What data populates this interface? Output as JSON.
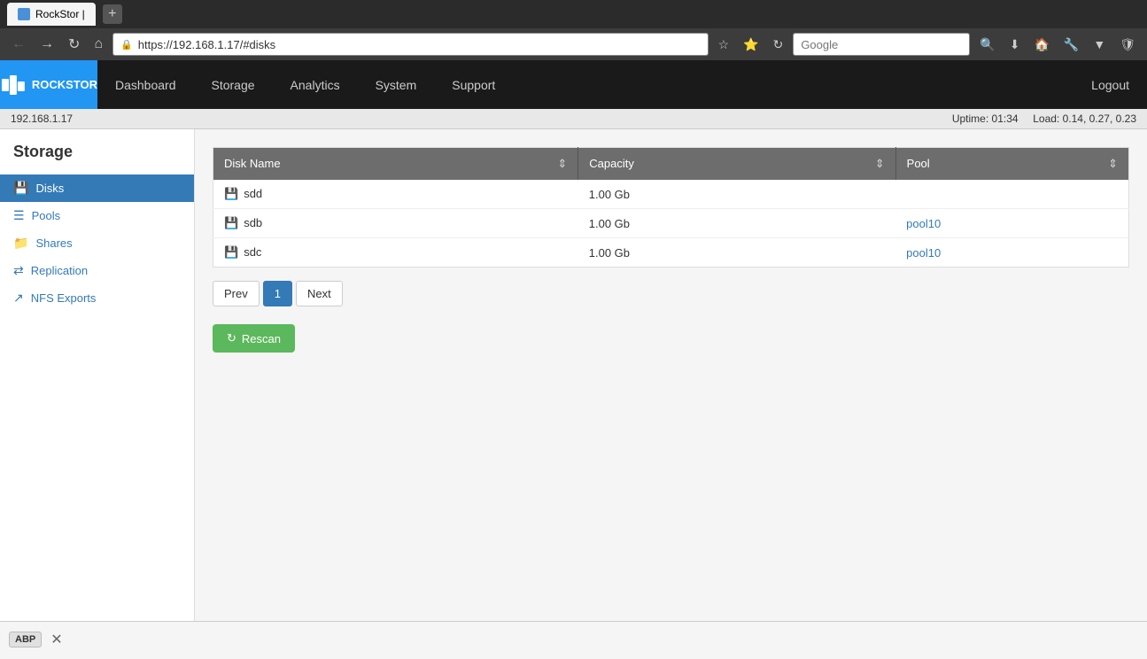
{
  "browser": {
    "tab_title": "RockStor |",
    "url": "https://192.168.1.17/#disks",
    "new_tab_symbol": "+",
    "search_placeholder": "Google"
  },
  "status_bar": {
    "ip": "192.168.1.17",
    "uptime_label": "Uptime: 01:34",
    "load_label": "Load: 0.14, 0.27, 0.23"
  },
  "app_header": {
    "logo_text": "ROCKSTOR",
    "nav_items": [
      {
        "id": "dashboard",
        "label": "Dashboard"
      },
      {
        "id": "storage",
        "label": "Storage"
      },
      {
        "id": "analytics",
        "label": "Analytics"
      },
      {
        "id": "system",
        "label": "System"
      },
      {
        "id": "support",
        "label": "Support"
      }
    ],
    "logout_label": "Logout"
  },
  "sidebar": {
    "title": "Storage",
    "items": [
      {
        "id": "disks",
        "label": "Disks",
        "icon": "💾",
        "active": true
      },
      {
        "id": "pools",
        "label": "Pools",
        "icon": "☰"
      },
      {
        "id": "shares",
        "label": "Shares",
        "icon": "📁"
      },
      {
        "id": "replication",
        "label": "Replication",
        "icon": "⇄"
      },
      {
        "id": "nfs-exports",
        "label": "NFS Exports",
        "icon": "↗"
      }
    ]
  },
  "table": {
    "columns": [
      {
        "id": "disk-name",
        "label": "Disk Name"
      },
      {
        "id": "capacity",
        "label": "Capacity"
      },
      {
        "id": "pool",
        "label": "Pool"
      }
    ],
    "rows": [
      {
        "disk_name": "sdd",
        "capacity": "1.00 Gb",
        "pool": "",
        "pool_link": null
      },
      {
        "disk_name": "sdb",
        "capacity": "1.00 Gb",
        "pool": "pool10",
        "pool_link": "pool10"
      },
      {
        "disk_name": "sdc",
        "capacity": "1.00 Gb",
        "pool": "pool10",
        "pool_link": "pool10"
      }
    ]
  },
  "pagination": {
    "prev_label": "Prev",
    "page_number": "1",
    "next_label": "Next"
  },
  "rescan_button": {
    "label": "Rescan",
    "icon": "↻"
  },
  "bottom_bar": {
    "adblock_label": "ABP",
    "close_symbol": "✕"
  },
  "colors": {
    "active_blue": "#337ab7",
    "header_dark": "#1a1a1a",
    "logo_blue": "#2196F3",
    "table_header": "#6d6d6d",
    "green_btn": "#5cb85c"
  }
}
